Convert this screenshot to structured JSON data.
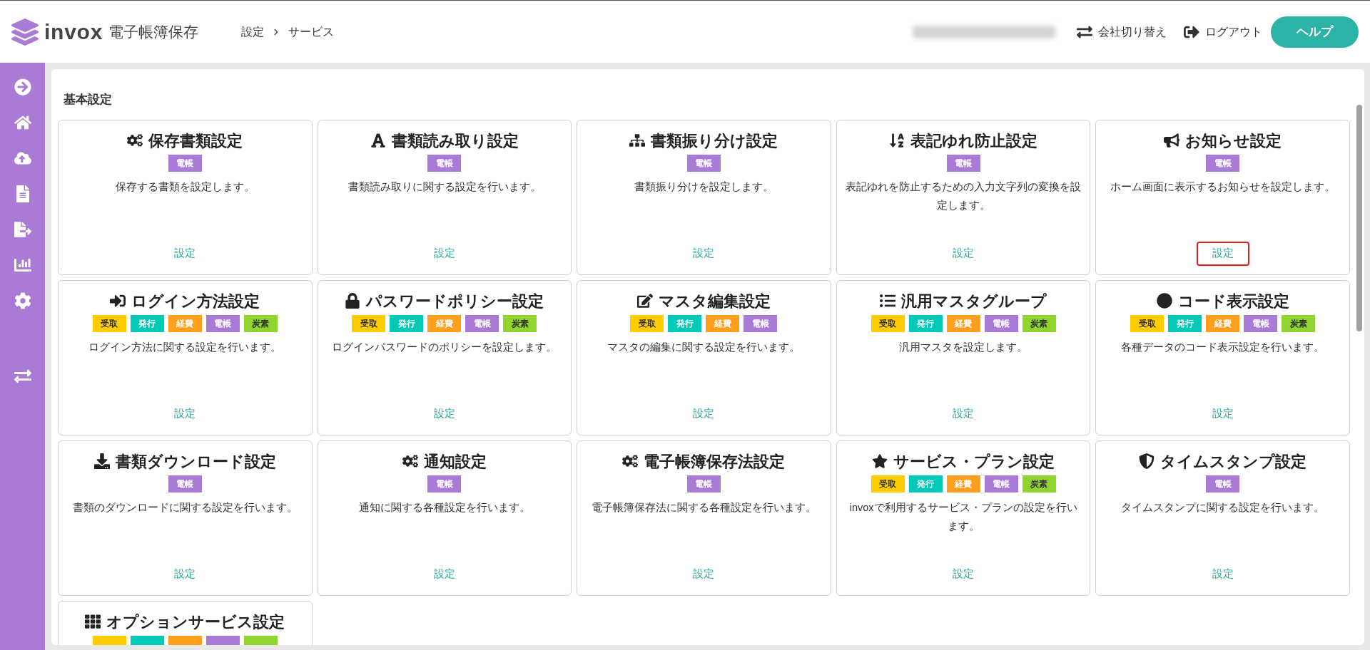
{
  "header": {
    "logo_text": "invox",
    "product": "電子帳簿保存",
    "breadcrumb": [
      "設定",
      "サービス"
    ],
    "switch_company": "会社切り替え",
    "logout": "ログアウト",
    "help": "ヘルプ"
  },
  "section_title": "基本設定",
  "cards": [
    {
      "title": "保存書類設定",
      "tags": [
        {
          "label": "電帳",
          "color": "#a97bd6"
        }
      ],
      "description": "保存する書類を設定します。",
      "link": "設定",
      "highlighted": false
    },
    {
      "title": "書類読み取り設定",
      "tags": [
        {
          "label": "電帳",
          "color": "#a97bd6"
        }
      ],
      "description": "書類読み取りに関する設定を行います。",
      "link": "設定",
      "highlighted": false
    },
    {
      "title": "書類振り分け設定",
      "tags": [
        {
          "label": "電帳",
          "color": "#a97bd6"
        }
      ],
      "description": "書類振り分けを設定します。",
      "link": "設定",
      "highlighted": false
    },
    {
      "title": "表記ゆれ防止設定",
      "tags": [
        {
          "label": "電帳",
          "color": "#a97bd6"
        }
      ],
      "description": "表記ゆれを防止するための入力文字列の変換を設定します。",
      "link": "設定",
      "highlighted": false
    },
    {
      "title": "お知らせ設定",
      "tags": [
        {
          "label": "電帳",
          "color": "#a97bd6"
        }
      ],
      "description": "ホーム画面に表示するお知らせを設定します。",
      "link": "設定",
      "highlighted": true
    },
    {
      "title": "ログイン方法設定",
      "tags": [
        {
          "label": "受取",
          "color": "#ffcc00"
        },
        {
          "label": "発行",
          "color": "#00c9b7"
        },
        {
          "label": "経費",
          "color": "#ff9f1c"
        },
        {
          "label": "電帳",
          "color": "#a97bd6"
        },
        {
          "label": "炭素",
          "color": "#8fd42f"
        }
      ],
      "description": "ログイン方法に関する設定を行います。",
      "link": "設定",
      "highlighted": false
    },
    {
      "title": "パスワードポリシー設定",
      "tags": [
        {
          "label": "受取",
          "color": "#ffcc00"
        },
        {
          "label": "発行",
          "color": "#00c9b7"
        },
        {
          "label": "経費",
          "color": "#ff9f1c"
        },
        {
          "label": "電帳",
          "color": "#a97bd6"
        },
        {
          "label": "炭素",
          "color": "#8fd42f"
        }
      ],
      "description": "ログインパスワードのポリシーを設定します。",
      "link": "設定",
      "highlighted": false
    },
    {
      "title": "マスタ編集設定",
      "tags": [
        {
          "label": "受取",
          "color": "#ffcc00"
        },
        {
          "label": "発行",
          "color": "#00c9b7"
        },
        {
          "label": "経費",
          "color": "#ff9f1c"
        },
        {
          "label": "電帳",
          "color": "#a97bd6"
        }
      ],
      "description": "マスタの編集に関する設定を行います。",
      "link": "設定",
      "highlighted": false
    },
    {
      "title": "汎用マスタグループ",
      "tags": [
        {
          "label": "受取",
          "color": "#ffcc00"
        },
        {
          "label": "発行",
          "color": "#00c9b7"
        },
        {
          "label": "経費",
          "color": "#ff9f1c"
        },
        {
          "label": "電帳",
          "color": "#a97bd6"
        },
        {
          "label": "炭素",
          "color": "#8fd42f"
        }
      ],
      "description": "汎用マスタを設定します。",
      "link": "設定",
      "highlighted": false
    },
    {
      "title": "コード表示設定",
      "tags": [
        {
          "label": "受取",
          "color": "#ffcc00"
        },
        {
          "label": "発行",
          "color": "#00c9b7"
        },
        {
          "label": "経費",
          "color": "#ff9f1c"
        },
        {
          "label": "電帳",
          "color": "#a97bd6"
        },
        {
          "label": "炭素",
          "color": "#8fd42f"
        }
      ],
      "description": "各種データのコード表示設定を行います。",
      "link": "設定",
      "highlighted": false
    },
    {
      "title": "書類ダウンロード設定",
      "tags": [
        {
          "label": "電帳",
          "color": "#a97bd6"
        }
      ],
      "description": "書類のダウンロードに関する設定を行います。",
      "link": "設定",
      "highlighted": false
    },
    {
      "title": "通知設定",
      "tags": [
        {
          "label": "電帳",
          "color": "#a97bd6"
        }
      ],
      "description": "通知に関する各種設定を行います。",
      "link": "設定",
      "highlighted": false
    },
    {
      "title": "電子帳簿保存法設定",
      "tags": [
        {
          "label": "電帳",
          "color": "#a97bd6"
        }
      ],
      "description": "電子帳簿保存法に関する各種設定を行います。",
      "link": "設定",
      "highlighted": false
    },
    {
      "title": "サービス・プラン設定",
      "tags": [
        {
          "label": "受取",
          "color": "#ffcc00"
        },
        {
          "label": "発行",
          "color": "#00c9b7"
        },
        {
          "label": "経費",
          "color": "#ff9f1c"
        },
        {
          "label": "電帳",
          "color": "#a97bd6"
        },
        {
          "label": "炭素",
          "color": "#8fd42f"
        }
      ],
      "description": "invoxで利用するサービス・プランの設定を行います。",
      "link": "設定",
      "highlighted": false
    },
    {
      "title": "タイムスタンプ設定",
      "tags": [
        {
          "label": "電帳",
          "color": "#a97bd6"
        }
      ],
      "description": "タイムスタンプに関する設定を行います。",
      "link": "設定",
      "highlighted": false
    },
    {
      "title": "オプションサービス設定",
      "tags": [
        {
          "color": "#ffcc00"
        },
        {
          "color": "#00c9b7"
        },
        {
          "color": "#ff9f1c"
        },
        {
          "color": "#a97bd6"
        },
        {
          "color": "#8fd42f"
        }
      ]
    }
  ]
}
